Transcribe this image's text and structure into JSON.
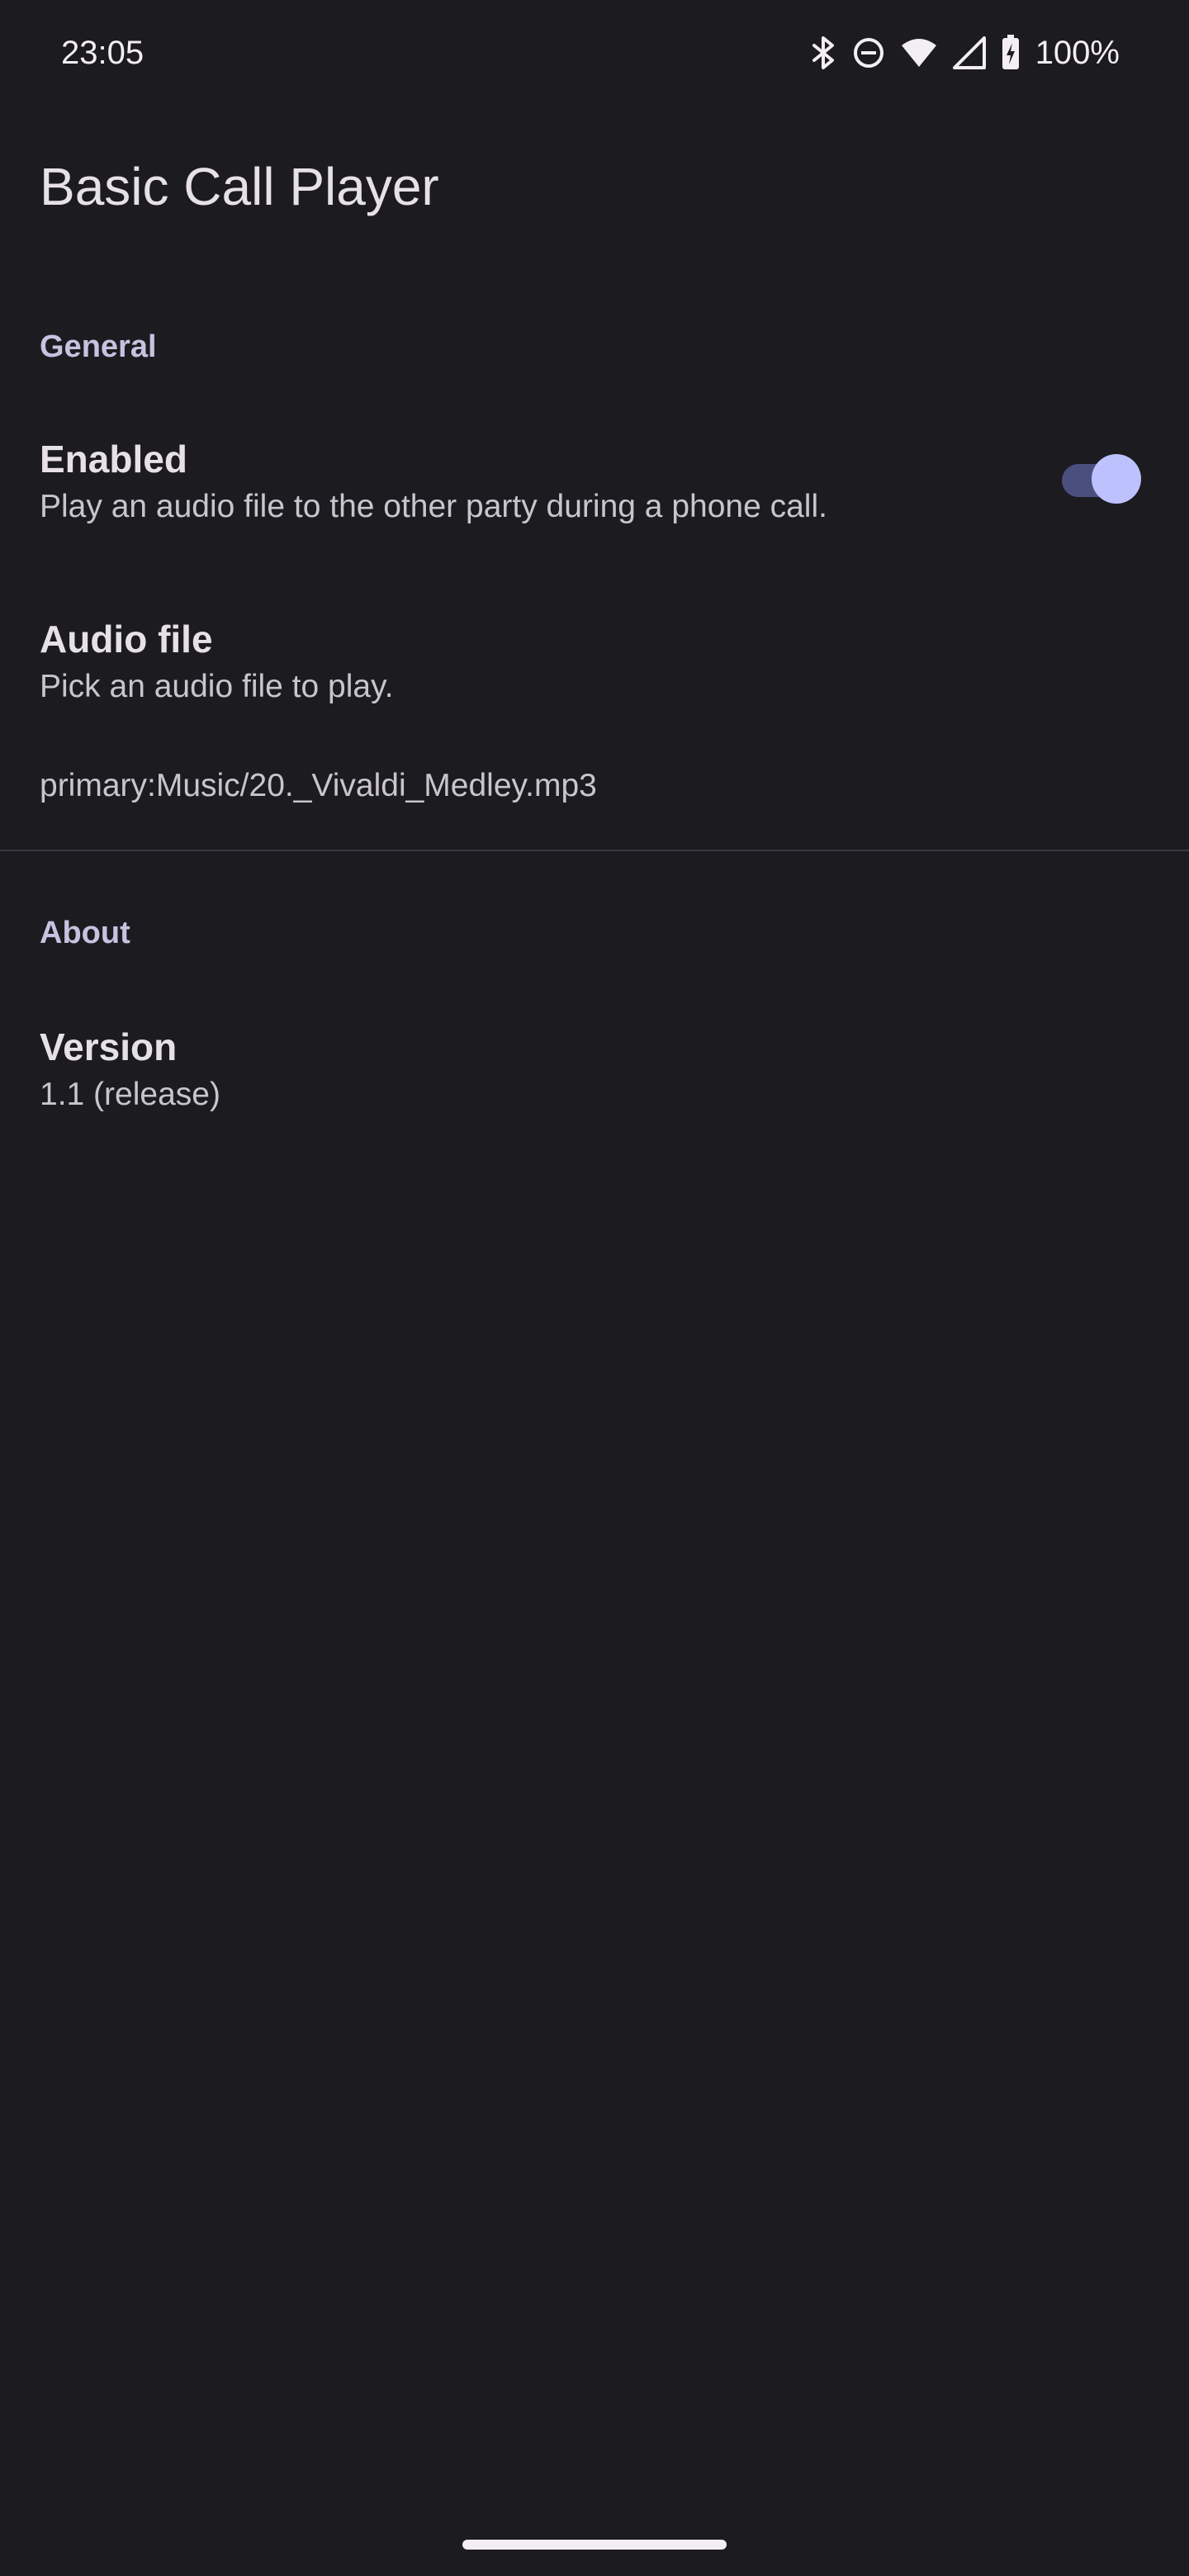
{
  "status_bar": {
    "time": "23:05",
    "battery_percent": "100%",
    "icons": [
      "bluetooth-icon",
      "do-not-disturb-icon",
      "wifi-icon",
      "cellular-signal-icon",
      "battery-charging-icon"
    ]
  },
  "app": {
    "title": "Basic Call Player"
  },
  "sections": {
    "general": {
      "header": "General",
      "enabled": {
        "title": "Enabled",
        "summary": "Play an audio file to the other party during a phone call.",
        "value": true
      },
      "audio_file": {
        "title": "Audio file",
        "summary": "Pick an audio file to play.",
        "value": "primary:Music/20._Vivaldi_Medley.mp3"
      }
    },
    "about": {
      "header": "About",
      "version": {
        "title": "Version",
        "summary": "1.1 (release)"
      }
    }
  },
  "colors": {
    "background": "#1c1b20",
    "accent": "#bdc2ff",
    "section_header": "#c6c2e0"
  }
}
